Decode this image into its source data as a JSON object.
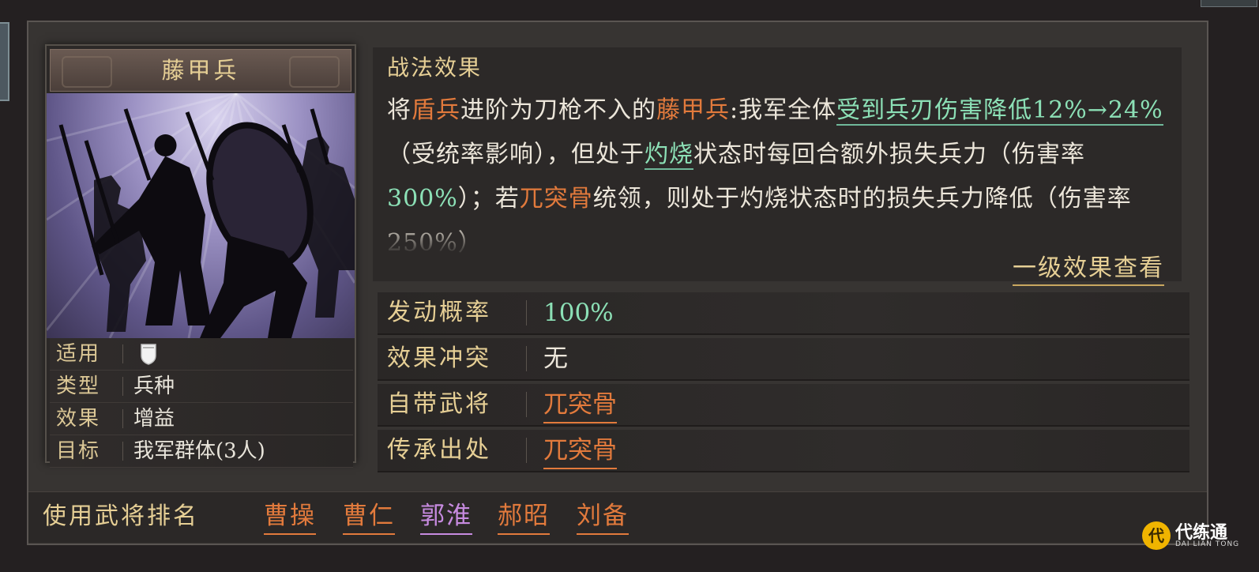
{
  "card": {
    "title": "藤甲兵",
    "attributes": [
      {
        "label": "适用",
        "value": "",
        "icon": "shield-icon"
      },
      {
        "label": "类型",
        "value": "兵种"
      },
      {
        "label": "效果",
        "value": "增益"
      },
      {
        "label": "目标",
        "value": "我军群体(3人)"
      }
    ]
  },
  "effect": {
    "title": "战法效果",
    "segments": [
      {
        "text": "将",
        "style": "white"
      },
      {
        "text": "盾兵",
        "style": "orange"
      },
      {
        "text": "进阶为刀枪不入的",
        "style": "white"
      },
      {
        "text": "藤甲兵",
        "style": "orange"
      },
      {
        "text": ":我军全体",
        "style": "white"
      },
      {
        "text": "受到兵刃伤害降低12%→24%",
        "style": "green-ul"
      },
      {
        "text": "（受统率影响），但处于",
        "style": "white"
      },
      {
        "text": "灼烧",
        "style": "green-ul"
      },
      {
        "text": "状态时每回合额外损失兵力（伤害率",
        "style": "white"
      },
      {
        "text": "300%",
        "style": "green"
      },
      {
        "text": "）；若",
        "style": "white"
      },
      {
        "text": "兀突骨",
        "style": "orange"
      },
      {
        "text": "统领，则处于灼烧状态时的损失兵力降低（伤害率250%）",
        "style": "white"
      }
    ],
    "view_level_label": "一级效果查看"
  },
  "info": [
    {
      "label": "发动概率",
      "value": "100%",
      "style": "green"
    },
    {
      "label": "效果冲突",
      "value": "无",
      "style": "white"
    },
    {
      "label": "自带武将",
      "value": "兀突骨",
      "style": "orange"
    },
    {
      "label": "传承出处",
      "value": "兀突骨",
      "style": "orange"
    }
  ],
  "ranking": {
    "label": "使用武将排名",
    "generals": [
      {
        "name": "曹操",
        "color": "#e27a3c"
      },
      {
        "name": "曹仁",
        "color": "#e27a3c"
      },
      {
        "name": "郭淮",
        "color": "#c78be0"
      },
      {
        "name": "郝昭",
        "color": "#e27a3c"
      },
      {
        "name": "刘备",
        "color": "#e27a3c"
      }
    ]
  },
  "watermark": {
    "logo": "代",
    "name": "代练通",
    "sub": "DAI LIAN TONG"
  }
}
